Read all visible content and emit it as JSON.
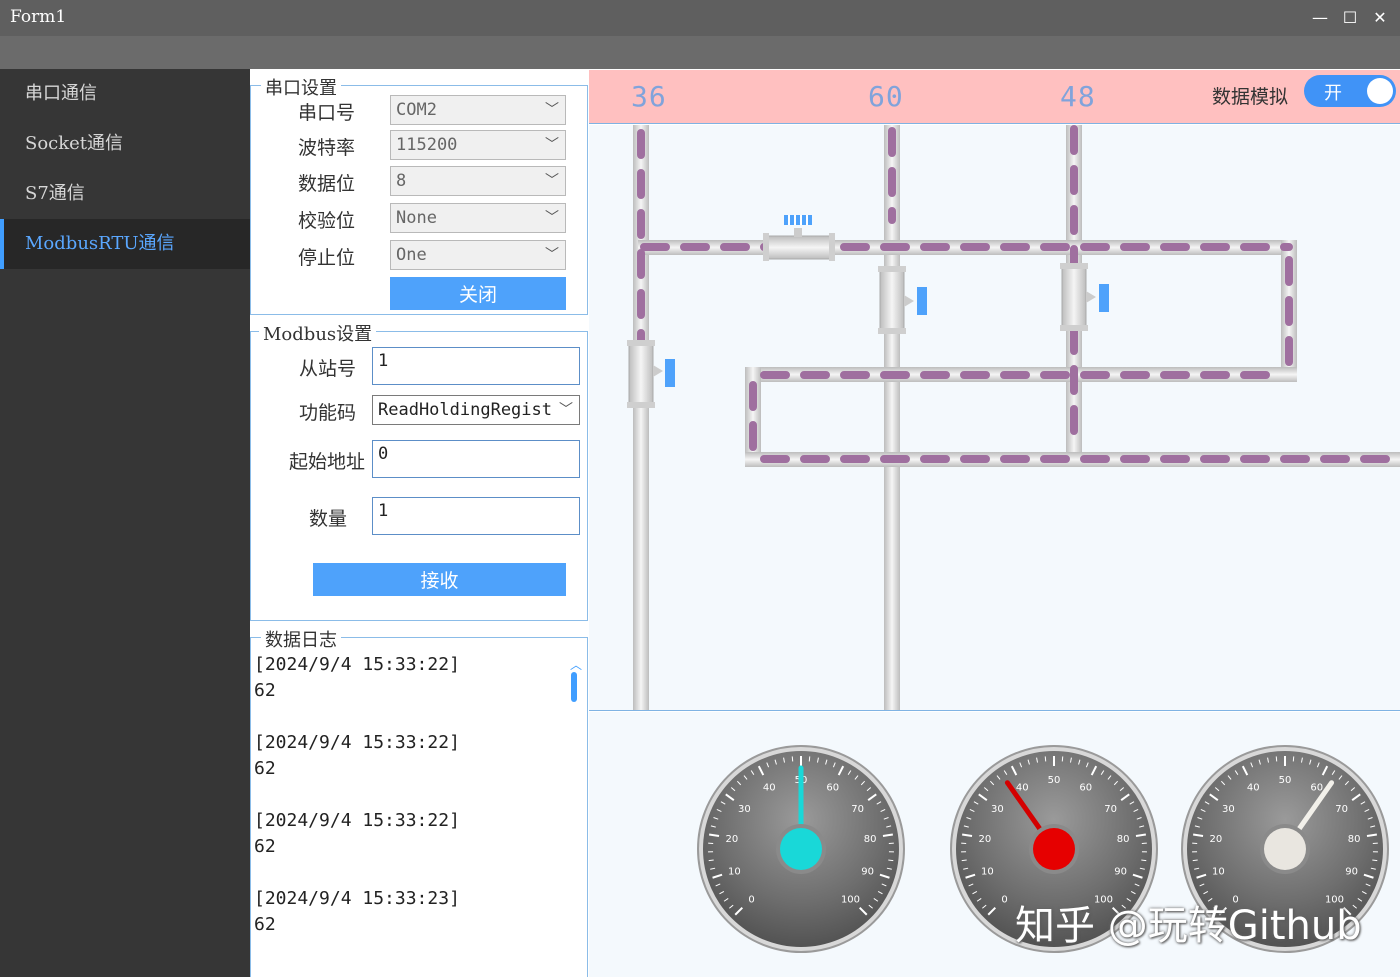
{
  "window": {
    "title": "Form1",
    "minimize": "—",
    "maximize": "☐",
    "close": "✕"
  },
  "sidebar": {
    "items": [
      {
        "label": "串口通信"
      },
      {
        "label": "Socket通信"
      },
      {
        "label": "S7通信"
      },
      {
        "label": "ModbusRTU通信",
        "active": true
      }
    ]
  },
  "serial": {
    "group_title": "串口设置",
    "port_label": "串口号",
    "port_value": "COM2",
    "baud_label": "波特率",
    "baud_value": "115200",
    "databits_label": "数据位",
    "databits_value": "8",
    "parity_label": "校验位",
    "parity_value": "None",
    "stopbits_label": "停止位",
    "stopbits_value": "One",
    "close_button": "关闭"
  },
  "modbus": {
    "group_title": "Modbus设置",
    "slave_label": "从站号",
    "slave_value": "1",
    "func_label": "功能码",
    "func_value": "ReadHoldingRegist",
    "start_label": "起始地址",
    "start_value": "0",
    "count_label": "数量",
    "count_value": "1",
    "receive_button": "接收"
  },
  "log": {
    "group_title": "数据日志",
    "entries": [
      {
        "time": "[2024/9/4 15:33:22]",
        "value": "62"
      },
      {
        "time": "[2024/9/4 15:33:22]",
        "value": "62"
      },
      {
        "time": "[2024/9/4 15:33:22]",
        "value": "62"
      },
      {
        "time": "[2024/9/4 15:33:23]",
        "value": "62"
      }
    ]
  },
  "display": {
    "values": [
      "36",
      "60",
      "48"
    ],
    "sim_label": "数据模拟",
    "toggle_label": "开",
    "toggle_on": true
  },
  "gauges": [
    {
      "value": 50,
      "hub_color": "#19d8d8",
      "needle_color": "#19d8d8"
    },
    {
      "value": 37,
      "hub_color": "#e60000",
      "needle_color": "#d40000"
    },
    {
      "value": 63,
      "hub_color": "#e9e6e0",
      "needle_color": "#f2f0ea"
    }
  ],
  "gauge_ticks": [
    "0",
    "10",
    "20",
    "30",
    "40",
    "50",
    "60",
    "70",
    "80",
    "90",
    "100"
  ],
  "watermark": "知乎 @玩转Github"
}
